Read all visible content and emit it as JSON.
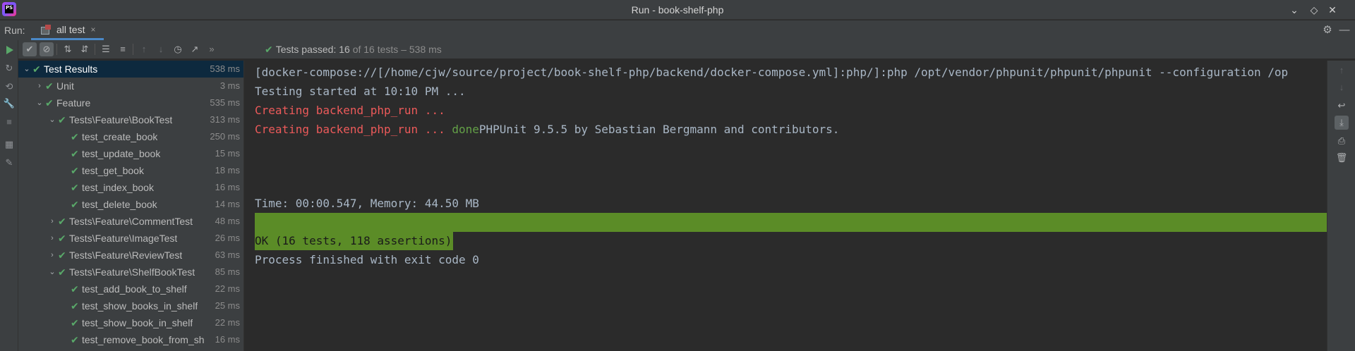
{
  "window": {
    "title": "Run - book-shelf-php",
    "logo_text": "PS"
  },
  "run": {
    "label": "Run:",
    "tab_label": "all test",
    "tab_close": "×"
  },
  "status": {
    "prefix": "Tests passed:",
    "passed": "16",
    "of_text": "of 16 tests",
    "dash": "–",
    "duration": "538 ms"
  },
  "tree": [
    {
      "label": "Test Results",
      "time": "538 ms",
      "level": 0,
      "arrow": "down",
      "selected": true
    },
    {
      "label": "Unit",
      "time": "3 ms",
      "level": 1,
      "arrow": "right"
    },
    {
      "label": "Feature",
      "time": "535 ms",
      "level": 1,
      "arrow": "down"
    },
    {
      "label": "Tests\\Feature\\BookTest",
      "time": "313 ms",
      "level": 2,
      "arrow": "down"
    },
    {
      "label": "test_create_book",
      "time": "250 ms",
      "level": 3,
      "arrow": ""
    },
    {
      "label": "test_update_book",
      "time": "15 ms",
      "level": 3,
      "arrow": ""
    },
    {
      "label": "test_get_book",
      "time": "18 ms",
      "level": 3,
      "arrow": ""
    },
    {
      "label": "test_index_book",
      "time": "16 ms",
      "level": 3,
      "arrow": ""
    },
    {
      "label": "test_delete_book",
      "time": "14 ms",
      "level": 3,
      "arrow": ""
    },
    {
      "label": "Tests\\Feature\\CommentTest",
      "time": "48 ms",
      "level": 2,
      "arrow": "right"
    },
    {
      "label": "Tests\\Feature\\ImageTest",
      "time": "26 ms",
      "level": 2,
      "arrow": "right"
    },
    {
      "label": "Tests\\Feature\\ReviewTest",
      "time": "63 ms",
      "level": 2,
      "arrow": "right"
    },
    {
      "label": "Tests\\Feature\\ShelfBookTest",
      "time": "85 ms",
      "level": 2,
      "arrow": "down"
    },
    {
      "label": "test_add_book_to_shelf",
      "time": "22 ms",
      "level": 3,
      "arrow": ""
    },
    {
      "label": "test_show_books_in_shelf",
      "time": "25 ms",
      "level": 3,
      "arrow": ""
    },
    {
      "label": "test_show_book_in_shelf",
      "time": "22 ms",
      "level": 3,
      "arrow": ""
    },
    {
      "label": "test_remove_book_from_sh",
      "time": "16 ms",
      "level": 3,
      "arrow": ""
    }
  ],
  "console": {
    "command": "[docker-compose://[/home/cjw/source/project/book-shelf-php/backend/docker-compose.yml]:php/]:php /opt/vendor/phpunit/phpunit/phpunit --configuration /op",
    "started": "Testing started at 10:10 PM ...",
    "creating1": "Creating backend_php_run ...",
    "creating2": "Creating backend_php_run ... ",
    "done_word": "done",
    "phpunit": "PHPUnit 9.5.5 by Sebastian Bergmann and contributors.",
    "time_memory": "Time: 00:00.547, Memory: 44.50 MB",
    "ok": "OK (16 tests, 118 assertions)",
    "exit": "Process finished with exit code 0"
  },
  "colors": {
    "pass_green": "#59a869",
    "error_red": "#ec5a5a",
    "ok_bar": "#5b8c27",
    "selection": "#0d293e"
  }
}
